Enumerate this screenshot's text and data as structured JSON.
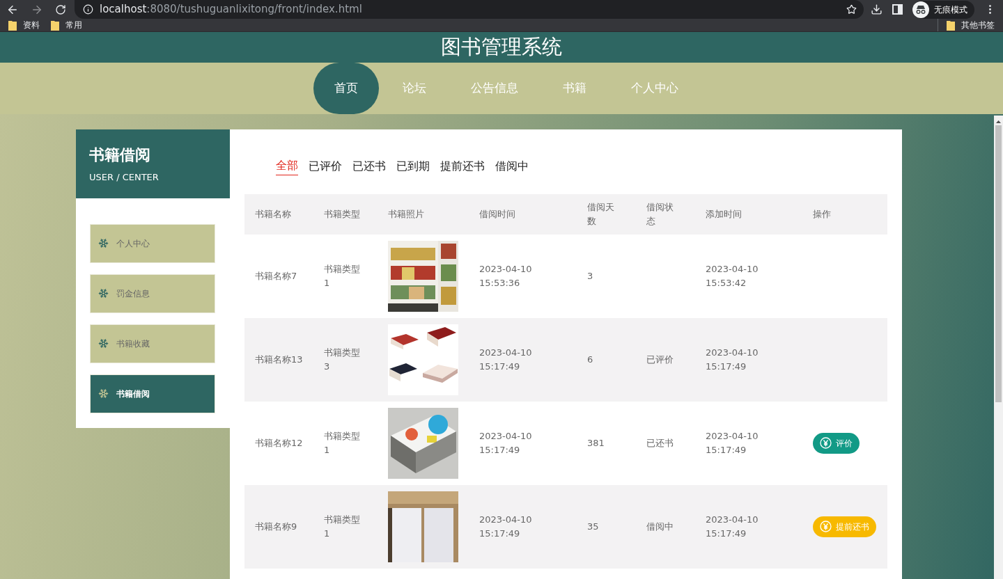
{
  "browser": {
    "address": {
      "host": "localhost",
      "path": ":8080/tushuguanlixitong/front/index.html"
    },
    "profile": "无痕模式",
    "bookmarks": [
      {
        "label": "资料"
      },
      {
        "label": "常用"
      }
    ],
    "other_bookmarks": "其他书签"
  },
  "header": {
    "title": "图书管理系统"
  },
  "nav": [
    {
      "label": "首页",
      "selected": true
    },
    {
      "label": "论坛",
      "selected": false
    },
    {
      "label": "公告信息",
      "selected": false
    },
    {
      "label": "书籍",
      "selected": false
    },
    {
      "label": "个人中心",
      "selected": false
    }
  ],
  "sidebar": {
    "title": "书籍借阅",
    "subtitle": "USER / CENTER",
    "items": [
      {
        "label": "个人中心",
        "selected": false
      },
      {
        "label": "罚金信息",
        "selected": false
      },
      {
        "label": "书籍收藏",
        "selected": false
      },
      {
        "label": "书籍借阅",
        "selected": true
      }
    ]
  },
  "tabs": [
    {
      "label": "全部",
      "selected": true
    },
    {
      "label": "已评价",
      "selected": false
    },
    {
      "label": "已还书",
      "selected": false
    },
    {
      "label": "已到期",
      "selected": false
    },
    {
      "label": "提前还书",
      "selected": false
    },
    {
      "label": "借阅中",
      "selected": false
    }
  ],
  "table": {
    "columns": [
      "书籍名称",
      "书籍类型",
      "书籍照片",
      "借阅时间",
      "借阅天数",
      "借阅状态",
      "添加时间",
      "操作"
    ],
    "rows": [
      {
        "name": "书籍名称7",
        "type": "书籍类型1",
        "borrow_time": "2023-04-10 15:53:36",
        "days": "3",
        "add_time": "2023-04-10 15:53:42"
      },
      {
        "name": "书籍名称13",
        "type": "书籍类型3",
        "borrow_time": "2023-04-10 15:17:49",
        "days": "6",
        "status": "已评价",
        "add_time": "2023-04-10 15:17:49"
      },
      {
        "name": "书籍名称12",
        "type": "书籍类型1",
        "borrow_time": "2023-04-10 15:17:49",
        "days": "381",
        "status": "已还书",
        "add_time": "2023-04-10 15:17:49",
        "action": {
          "kind": "review",
          "label": "评价"
        }
      },
      {
        "name": "书籍名称9",
        "type": "书籍类型1",
        "borrow_time": "2023-04-10 15:17:49",
        "days": "35",
        "status": "借阅中",
        "add_time": "2023-04-10 15:17:49",
        "action": {
          "kind": "early",
          "label": "提前还书"
        }
      }
    ]
  }
}
